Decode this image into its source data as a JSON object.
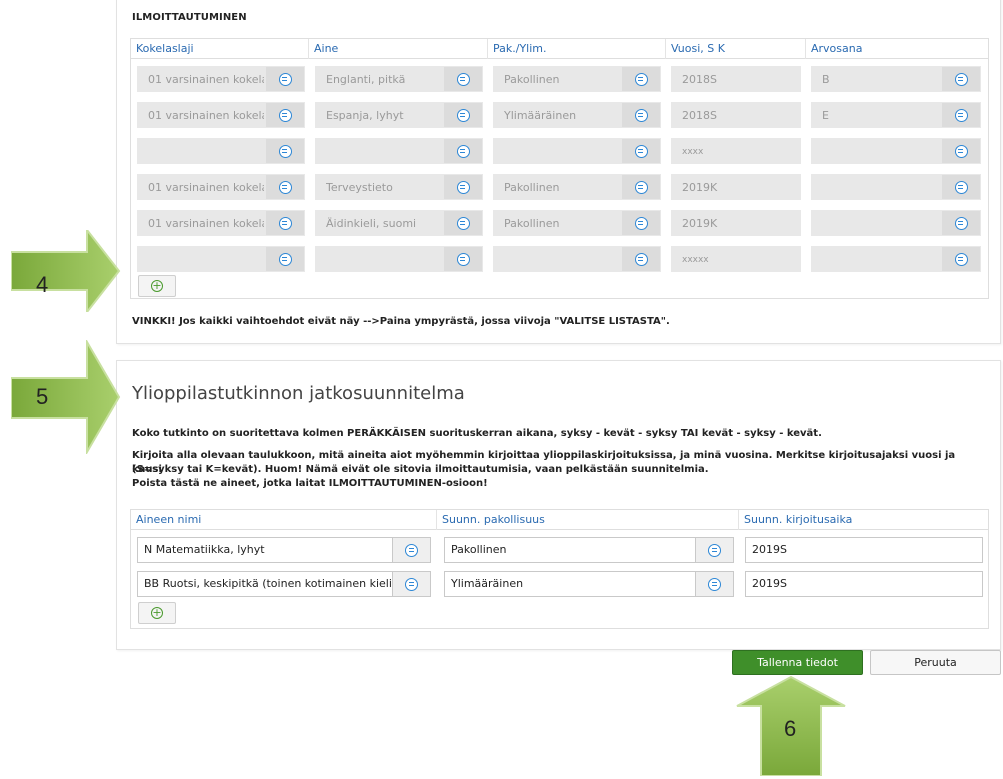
{
  "registration": {
    "title": "ILMOITTAUTUMINEN",
    "headers": [
      "Kokelaslaji",
      "Aine",
      "Pak./Ylim.",
      "Vuosi, S K",
      "Arvosana"
    ],
    "rows": [
      [
        "01 varsinainen kokela",
        "Englanti, pitkä",
        "Pakollinen",
        "2018S",
        "B"
      ],
      [
        "01 varsinainen kokela",
        "Espanja, lyhyt",
        "Ylimääräinen",
        "2018S",
        "E"
      ],
      [
        "",
        "",
        "",
        "xxxx",
        ""
      ],
      [
        "01 varsinainen kokela",
        "Terveystieto",
        "Pakollinen",
        "2019K",
        ""
      ],
      [
        "01 varsinainen kokela",
        "Äidinkieli, suomi",
        "Pakollinen",
        "2019K",
        ""
      ],
      [
        "",
        "",
        "",
        "xxxxx",
        ""
      ]
    ],
    "tip": "VINKKI! Jos kaikki vaihtoehdot eivät näy -->Paina ympyrästä, jossa viivoja \"VALITSE LISTASTA\"."
  },
  "plan": {
    "title": "Ylioppilastutkinnon jatkosuunnitelma",
    "para1": "Koko tutkinto on suoritettava kolmen PERÄKKÄISEN suorituskerran aikana, syksy - kevät - syksy TAI kevät - syksy - kevät.",
    "para2_line1": "Kirjoita alla olevaan taulukkoon, mitä aineita aiot myöhemmin kirjoittaa ylioppilaskirjoituksissa, ja minä vuosina. Merkitse kirjoitusajaksi vuosi ja kausi",
    "para2_line2": "(S=syksy tai K=kevät). Huom! Nämä eivät ole sitovia ilmoittautumisia, vaan pelkästään suunnitelmia.",
    "para2_line3": "Poista tästä ne aineet, jotka laitat ILMOITTAUTUMINEN-osioon!",
    "headers": [
      "Aineen nimi",
      "Suunn. pakollisuus",
      "Suunn. kirjoitusaika"
    ],
    "rows": [
      [
        "N Matematiikka, lyhyt",
        "Pakollinen",
        "2019S"
      ],
      [
        "BB Ruotsi, keskipitkä (toinen kotimainen kieli",
        "Ylimääräinen",
        "2019S"
      ]
    ]
  },
  "actions": {
    "save": "Tallenna tiedot",
    "cancel": "Peruuta"
  },
  "callouts": {
    "c4": "4",
    "c5": "5",
    "c6": "6"
  },
  "colors": {
    "accent": "#2a6ab1",
    "save": "#3f8f2a",
    "arrow": "#8fba4c"
  }
}
